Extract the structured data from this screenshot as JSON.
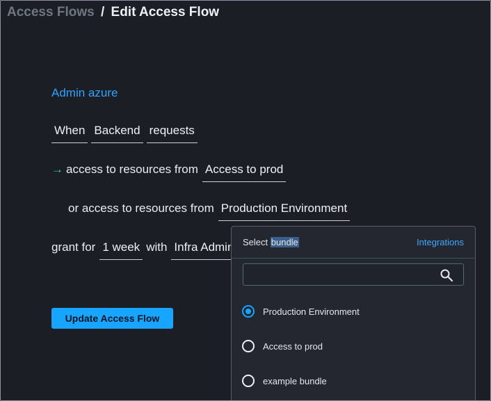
{
  "breadcrumb": {
    "parent": "Access Flows",
    "separator": "/",
    "current": "Edit Access Flow"
  },
  "flow_name": "Admin azure",
  "rule": {
    "when_label": "When",
    "requester": "Backend",
    "action": "requests",
    "arrow": "→",
    "access_prefix": "access to resources from",
    "primary_bundle": "Access to prod",
    "or_prefix": "or access to resources from",
    "secondary_bundle": "Production Environment",
    "grant_prefix": "grant for",
    "duration": "1 week",
    "with_label": "with",
    "approver": "Infra Admins"
  },
  "update_button": "Update Access Flow",
  "dropdown": {
    "title_prefix": "Select ",
    "title_highlight": "bundle",
    "integrations_link": "Integrations",
    "search_value": "",
    "search_icon": "search-icon",
    "options": [
      {
        "label": "Production Environment",
        "selected": true
      },
      {
        "label": "Access to prod",
        "selected": false
      },
      {
        "label": "example bundle",
        "selected": false
      }
    ]
  },
  "colors": {
    "accent": "#17a5ff",
    "link": "#2fa3ff",
    "arrow": "#2bd1a6",
    "background": "#1b1e25"
  }
}
